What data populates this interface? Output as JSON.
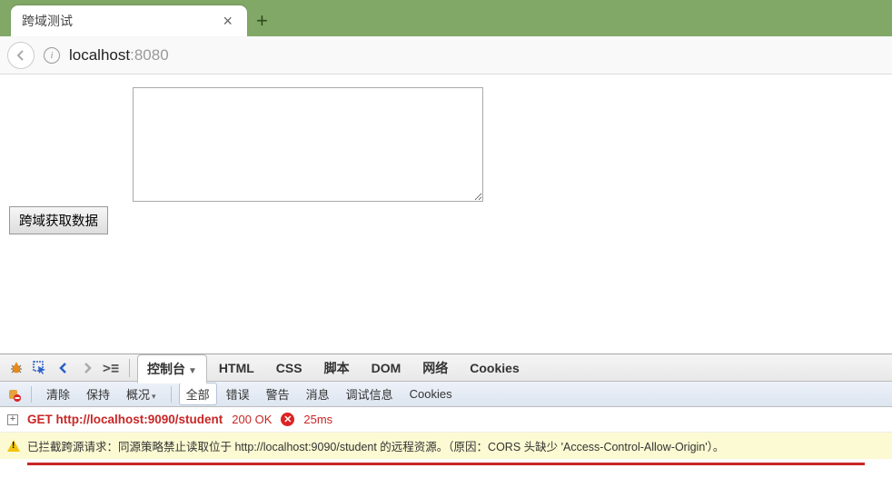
{
  "browser": {
    "tab_title": "跨域测试",
    "url_host": "localhost",
    "url_port": ":8080"
  },
  "page": {
    "textarea_value": "",
    "button_label": "跨域获取数据"
  },
  "devtools": {
    "tabs": {
      "console": "控制台",
      "html": "HTML",
      "css": "CSS",
      "script": "脚本",
      "dom": "DOM",
      "net": "网络",
      "cookies": "Cookies"
    },
    "subtabs": {
      "clear": "清除",
      "persist": "保持",
      "profile": "概况",
      "all": "全部",
      "errors": "错误",
      "warnings": "警告",
      "info": "消息",
      "debug": "调试信息",
      "cookies": "Cookies"
    },
    "request": {
      "method_url": "GET http://localhost:9090/student",
      "status": "200 OK",
      "time": "25ms"
    },
    "warning": "已拦截跨源请求：同源策略禁止读取位于 http://localhost:9090/student 的远程资源。（原因：CORS 头缺少 'Access-Control-Allow-Origin'）。"
  }
}
